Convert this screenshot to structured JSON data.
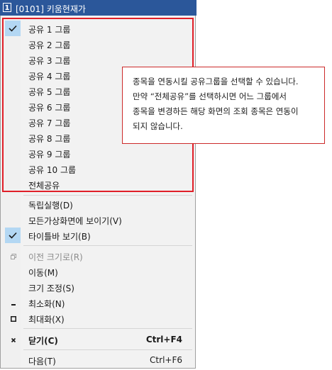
{
  "window": {
    "number_badge": "1",
    "title": "[0101] 키움현재가"
  },
  "share_groups": [
    {
      "label": "공유 1 그룹",
      "checked": true
    },
    {
      "label": "공유 2 그룹",
      "checked": false
    },
    {
      "label": "공유 3 그룹",
      "checked": false
    },
    {
      "label": "공유 4 그룹",
      "checked": false
    },
    {
      "label": "공유 5 그룹",
      "checked": false
    },
    {
      "label": "공유 6 그룹",
      "checked": false
    },
    {
      "label": "공유 7 그룹",
      "checked": false
    },
    {
      "label": "공유 8 그룹",
      "checked": false
    },
    {
      "label": "공유 9 그룹",
      "checked": false
    },
    {
      "label": "공유 10 그룹",
      "checked": false
    },
    {
      "label": "전체공유",
      "checked": false
    }
  ],
  "options": [
    {
      "label": "독립실행(D)",
      "checked": false
    },
    {
      "label": "모든가상화면에 보이기(V)",
      "checked": false
    },
    {
      "label": "타이틀바 보기(B)",
      "checked": true
    }
  ],
  "window_commands": [
    {
      "label": "이전 크기로(R)",
      "disabled": true,
      "icon": "restore-icon"
    },
    {
      "label": "이동(M)",
      "disabled": false
    },
    {
      "label": "크기 조정(S)",
      "disabled": false
    },
    {
      "label": "최소화(N)",
      "disabled": false,
      "icon": "minimize-icon"
    },
    {
      "label": "최대화(X)",
      "disabled": false,
      "icon": "maximize-icon"
    }
  ],
  "close": {
    "label": "닫기(C)",
    "shortcut": "Ctrl+F4",
    "icon": "close-icon"
  },
  "next": {
    "label": "다음(T)",
    "shortcut": "Ctrl+F6"
  },
  "callout": {
    "lines": [
      "종목을 연동시킬 공유그룹을 선택할 수 있습니다.",
      "만약 “전체공유”를 선택하시면 어느 그룹에서",
      "종목을 변경하든 해당 화면의 조회 종목은 연동이",
      "되지 않습니다."
    ]
  },
  "colors": {
    "title_bar": "#2b579a",
    "highlight_border": "#e01f28",
    "check_bg": "#b3d7f3"
  }
}
